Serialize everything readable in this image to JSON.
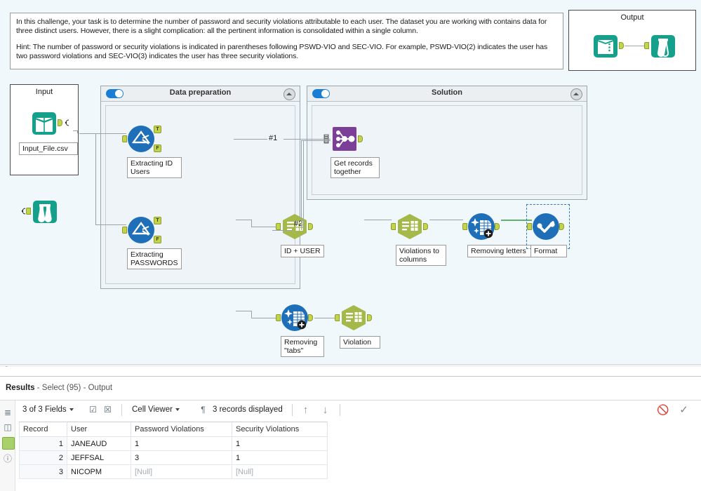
{
  "description": {
    "paragraphs": [
      "In this challenge, your task is to determine the number of password and security violations attributable to each user. The dataset you are working with contains data for three distinct users. However, there is a slight complication: all the pertinent information is consolidated within a single column.",
      "Hint: The number of password or security violations is indicated in parentheses following PSWD-VIO and SEC-VIO. For example, PSWD-VIO(2) indicates the user has two password violations and SEC-VIO(3) indicates the user has three security violations."
    ]
  },
  "containers": {
    "output": {
      "title": "Output"
    },
    "input": {
      "title": "Input"
    },
    "dataprep": {
      "title": "Data preparation",
      "enabled": true
    },
    "solution": {
      "title": "Solution",
      "enabled": true
    }
  },
  "tools": {
    "input_file": {
      "label": "Input_File.csv",
      "icon": "input-data-icon"
    },
    "browse_loose": {
      "icon": "browse-icon"
    },
    "extracting_id_users": {
      "label": "Extracting ID\nUsers",
      "icon": "filter-icon",
      "true_anchor": "T",
      "false_anchor": "F"
    },
    "id_user": {
      "label": "ID + USER",
      "icon": "select-icon"
    },
    "extracting_passwords": {
      "label": "Extracting\nPASSWORDS",
      "icon": "filter-icon",
      "true_anchor": "T",
      "false_anchor": "F"
    },
    "removing_tabs": {
      "label": "Removing\n\"tabs\"",
      "icon": "data-cleansing-icon"
    },
    "violation": {
      "label": "Violation",
      "icon": "select-icon"
    },
    "get_records_together": {
      "label": "Get records\ntogether",
      "icon": "join-multiple-icon"
    },
    "violations_to_columns": {
      "label": "Violations to\ncolumns",
      "icon": "select-icon"
    },
    "removing_letters": {
      "label": "Removing letters",
      "icon": "data-cleansing-icon"
    },
    "format": {
      "label": "Format",
      "icon": "formula-icon",
      "selected": true
    },
    "output_browse_book": {
      "icon": "input-data-icon"
    },
    "output_browse": {
      "icon": "browse-icon"
    }
  },
  "connection_labels": {
    "one": "#1",
    "two": "#2"
  },
  "results": {
    "title_prefix": "Results",
    "title_suffix": "- Select (95) - Output",
    "toolbar": {
      "fields": "3 of 3 Fields",
      "check_icon": "check-box-icon",
      "uncheck_icon": "x-box-icon",
      "cell_viewer": "Cell Viewer",
      "pilcrow_icon": "pilcrow-icon",
      "records": "3 records displayed",
      "up_icon": "arrow-up-icon",
      "down_icon": "arrow-down-icon",
      "block_icon": "no-errors-icon",
      "check_mark_icon": "check-mark-icon"
    },
    "sidebar_icons": [
      "list-icon",
      "layout-icon",
      "data-icon",
      "help-icon"
    ],
    "table": {
      "columns": [
        "Record",
        "User",
        "Password Violations",
        "Security Violations"
      ],
      "rows": [
        {
          "record": "1",
          "user": "JANEAUD",
          "password_violations": "1",
          "security_violations": "1"
        },
        {
          "record": "2",
          "user": "JEFFSAL",
          "password_violations": "3",
          "security_violations": "1"
        },
        {
          "record": "3",
          "user": "NICOPM",
          "password_violations": "[Null]",
          "security_violations": "[Null]"
        }
      ]
    }
  },
  "colors": {
    "canvas_bg": "#f0f8fc",
    "teal": "#14a08a",
    "filter_blue": "#1f6fb8",
    "select_olive": "#a5b84a",
    "join_purple": "#7b3f98",
    "anchor_green": "#c3d34a",
    "toggle_blue": "#1a7fd4"
  }
}
